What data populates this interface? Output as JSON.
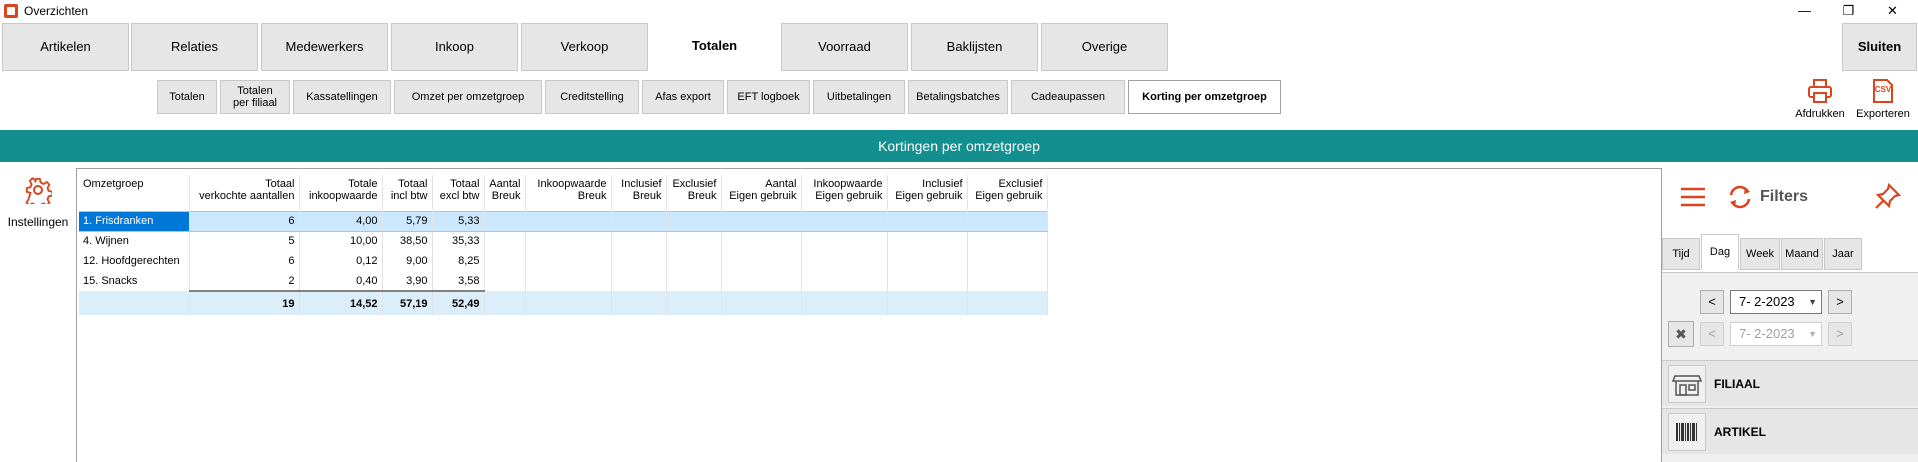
{
  "window": {
    "title": "Overzichten",
    "minimize": "—",
    "restore": "❐",
    "close": "✕"
  },
  "main_tabs": [
    {
      "label": "Artikelen"
    },
    {
      "label": "Relaties"
    },
    {
      "label": "Medewerkers"
    },
    {
      "label": "Inkoop"
    },
    {
      "label": "Verkoop"
    },
    {
      "label": "Totalen"
    },
    {
      "label": "Voorraad"
    },
    {
      "label": "Baklijsten"
    },
    {
      "label": "Overige"
    }
  ],
  "close_button": "Sluiten",
  "sub_tabs": [
    {
      "label": "Totalen"
    },
    {
      "label": "Totalen per filiaal"
    },
    {
      "label": "Kassatellingen"
    },
    {
      "label": "Omzet per omzetgroep"
    },
    {
      "label": "Creditstelling"
    },
    {
      "label": "Afas export"
    },
    {
      "label": "EFT logboek"
    },
    {
      "label": "Uitbetalingen"
    },
    {
      "label": "Betalingsbatches"
    },
    {
      "label": "Cadeaupassen"
    },
    {
      "label": "Korting per omzetgroep"
    }
  ],
  "toolbar": {
    "print_label": "Afdrukken",
    "export_label": "Exporteren",
    "export_icon_text": "CSV"
  },
  "banner": "Kortingen  per omzetgroep",
  "settings_label": "Instellingen",
  "table": {
    "columns": [
      [
        "Omzetgroep",
        ""
      ],
      [
        "Totaal",
        "verkochte aantallen"
      ],
      [
        "Totale",
        "inkoopwaarde"
      ],
      [
        "Totaal",
        "incl btw"
      ],
      [
        "Totaal",
        "excl btw"
      ],
      [
        "Aantal",
        "Breuk"
      ],
      [
        "Inkoopwaarde",
        "Breuk"
      ],
      [
        "Inclusief",
        "Breuk"
      ],
      [
        "Exclusief",
        "Breuk"
      ],
      [
        "Aantal",
        "Eigen gebruik"
      ],
      [
        "Inkoopwaarde",
        "Eigen gebruik"
      ],
      [
        "Inclusief",
        "Eigen gebruik"
      ],
      [
        "Exclusief",
        "Eigen gebruik"
      ]
    ],
    "rows": [
      [
        "1. Frisdranken",
        "6",
        "4,00",
        "5,79",
        "5,33",
        "",
        "",
        "",
        "",
        "",
        "",
        "",
        ""
      ],
      [
        "4. Wijnen",
        "5",
        "10,00",
        "38,50",
        "35,33",
        "",
        "",
        "",
        "",
        "",
        "",
        "",
        ""
      ],
      [
        "12. Hoofdgerechten",
        "6",
        "0,12",
        "9,00",
        "8,25",
        "",
        "",
        "",
        "",
        "",
        "",
        "",
        ""
      ],
      [
        "15. Snacks",
        "2",
        "0,40",
        "3,90",
        "3,58",
        "",
        "",
        "",
        "",
        "",
        "",
        "",
        ""
      ]
    ],
    "totals": [
      "",
      "19",
      "14,52",
      "57,19",
      "52,49",
      "",
      "",
      "",
      "",
      "",
      "",
      "",
      ""
    ]
  },
  "filters": {
    "title": "Filters",
    "tabs": [
      {
        "label": "Tijd"
      },
      {
        "label": "Dag"
      },
      {
        "label": "Week"
      },
      {
        "label": "Maand"
      },
      {
        "label": "Jaar"
      }
    ],
    "date_from": "7-  2-2023",
    "date_to": "7-  2-2023",
    "prev": "<",
    "next": ">",
    "sections": [
      {
        "label": "FILIAAL"
      },
      {
        "label": "ARTIKEL"
      }
    ]
  },
  "colors": {
    "accent": "#138f90",
    "icon_orange": "#d9451f",
    "selection": "#0078d7"
  }
}
